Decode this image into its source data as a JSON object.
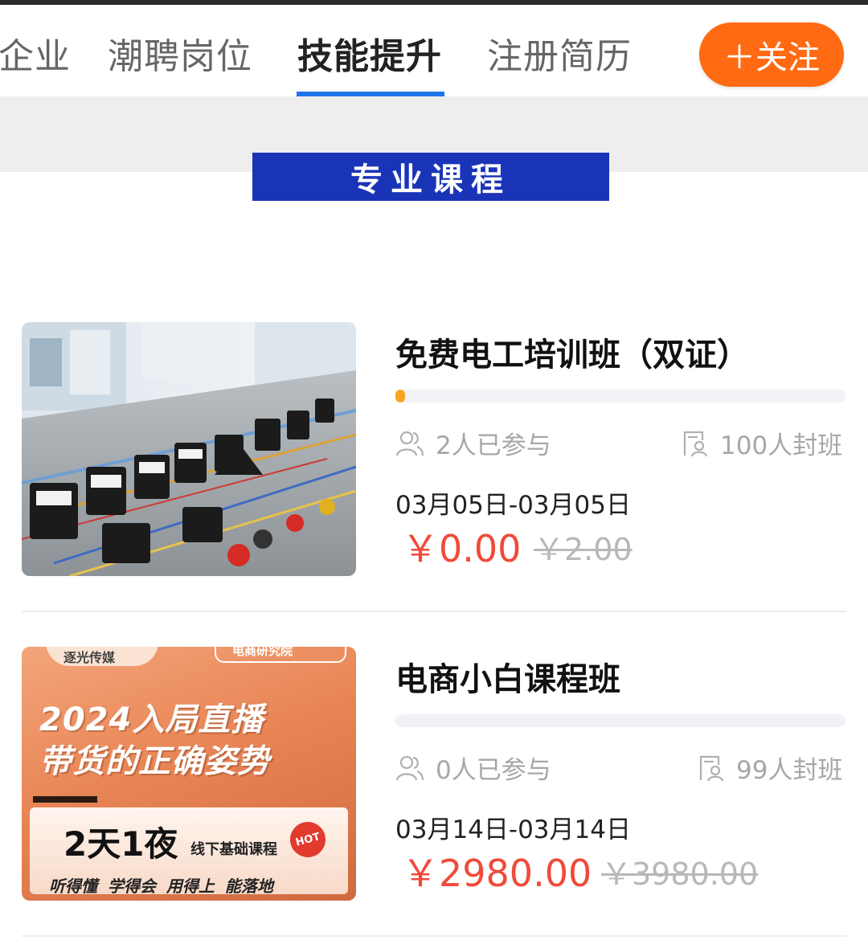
{
  "tabs": [
    {
      "label": "企业"
    },
    {
      "label": "潮聘岗位"
    },
    {
      "label": "技能提升",
      "active": true
    },
    {
      "label": "注册简历"
    }
  ],
  "follow_button": {
    "label": "＋关注",
    "color": "#ff6a13"
  },
  "section": {
    "title": "专业课程",
    "color": "#1a34b8"
  },
  "accent": {
    "tab_underline": "#1e74e8",
    "price": "#f04a3a",
    "progress": "#f5a623"
  },
  "courses": [
    {
      "title": "免费电工培训班（双证）",
      "progress_fraction": 0.02,
      "participants": "2人已参与",
      "capacity": "100人封班",
      "dates": "03月05日-03月05日",
      "price": "￥0.00",
      "original_price": "￥2.00",
      "image": {
        "icon": "electrical-training-photo"
      }
    },
    {
      "title": "电商小白课程班",
      "progress_fraction": 0,
      "participants": "0人已参与",
      "capacity": "99人封班",
      "dates": "03月14日-03月14日",
      "price": "￥2980.00",
      "original_price": "￥3980.00",
      "image": {
        "brand": "逐光传媒",
        "tag": "电商研究院",
        "headline_1": "2024入局直播",
        "headline_2": "带货的正确姿势",
        "duration": "2天1夜",
        "course_type": "线下基础课程",
        "hot": "HOT",
        "slogan": "听得懂 学得会 用得上 能落地"
      }
    }
  ]
}
